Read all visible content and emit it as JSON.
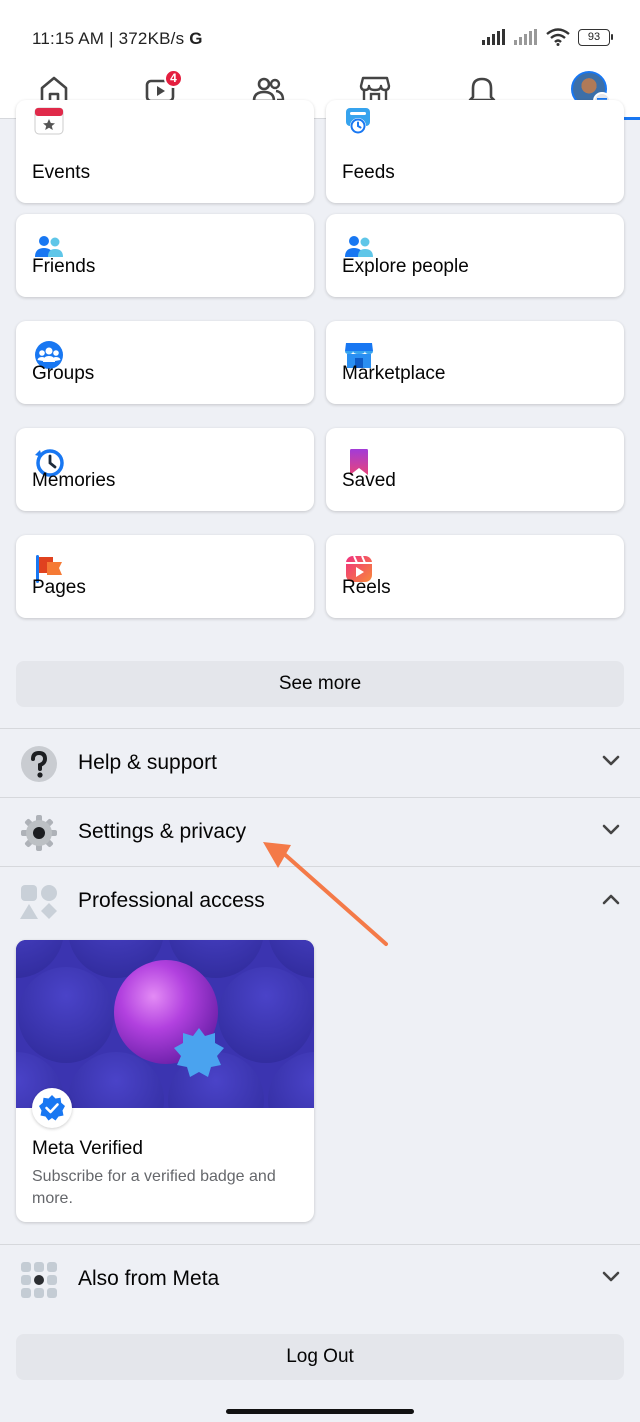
{
  "status_bar": {
    "time": "11:15 AM | 372KB/s",
    "g_mark": "G",
    "battery": "93"
  },
  "nav": {
    "watch_badge": "4",
    "items": [
      "home-icon",
      "watch-icon",
      "friends-icon",
      "marketplace-icon",
      "notifications-icon",
      "menu-avatar"
    ],
    "active": "menu-avatar"
  },
  "shortcuts": [
    {
      "label": "Events",
      "icon": "calendar-icon"
    },
    {
      "label": "Feeds",
      "icon": "feeds-icon"
    },
    {
      "label": "Friends",
      "icon": "friends-icon"
    },
    {
      "label": "Explore people",
      "icon": "explore-people-icon"
    },
    {
      "label": "Groups",
      "icon": "groups-icon"
    },
    {
      "label": "Marketplace",
      "icon": "marketplace-icon"
    },
    {
      "label": "Memories",
      "icon": "memories-icon"
    },
    {
      "label": "Saved",
      "icon": "bookmark-icon"
    },
    {
      "label": "Pages",
      "icon": "flag-icon"
    },
    {
      "label": "Reels",
      "icon": "reels-icon"
    }
  ],
  "see_more": "See more",
  "sections": {
    "help": "Help & support",
    "settings": "Settings & privacy",
    "professional": "Professional access",
    "also_from_meta": "Also from Meta"
  },
  "meta_verified": {
    "title": "Meta Verified",
    "description": "Subscribe for a verified badge and more."
  },
  "logout": "Log Out",
  "colors": {
    "accent": "#1877f2",
    "badge": "#e41e3f",
    "annotation_arrow": "#f47a48"
  }
}
